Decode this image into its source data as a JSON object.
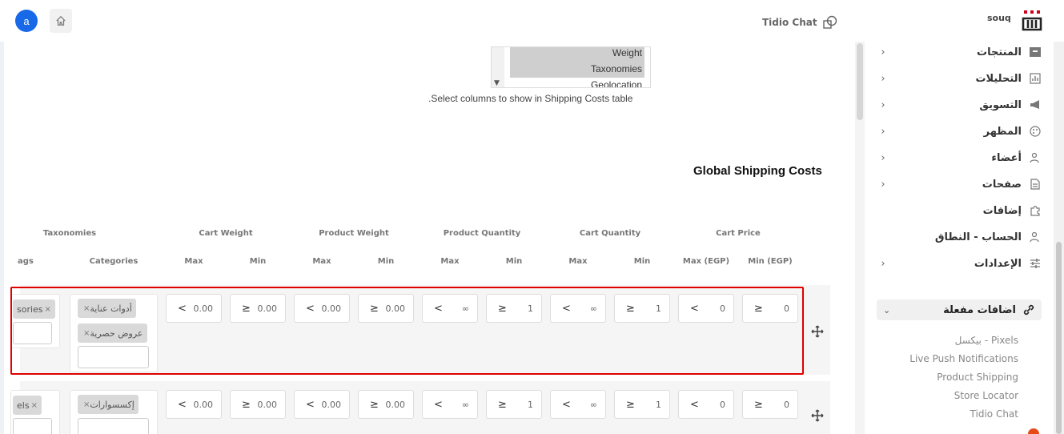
{
  "topbar": {
    "avatar_letter": "a",
    "tidio_label": "Tidio Chat",
    "brand_name": "souq"
  },
  "sidebar": {
    "items": [
      {
        "label": "المنتجات",
        "icon": "archive-icon"
      },
      {
        "label": "التحليلات",
        "icon": "chart-icon"
      },
      {
        "label": "التسويق",
        "icon": "megaphone-icon"
      },
      {
        "label": "المظهر",
        "icon": "palette-icon"
      },
      {
        "label": "أعضاء",
        "icon": "users-icon"
      },
      {
        "label": "صفحات",
        "icon": "page-icon"
      },
      {
        "label": "إضافات",
        "icon": "puzzle-icon"
      },
      {
        "label": "الحساب - النطاق",
        "icon": "user-account-icon"
      },
      {
        "label": "الإعدادات",
        "icon": "sliders-icon"
      }
    ],
    "active_group": {
      "label": "اضافات مفعلة",
      "icon": "link-icon"
    },
    "sub_items": [
      "بيكسل - Pixels",
      "Live Push Notifications",
      "Product Shipping",
      "Store Locator",
      "Tidio Chat"
    ]
  },
  "columns_select": {
    "options": [
      "Weight",
      "Taxonomies",
      "Geolocation"
    ],
    "hint": ".Select columns to show in Shipping Costs table"
  },
  "section_title": "Global Shipping Costs",
  "table": {
    "group_headers": [
      "Cart Price",
      "Cart Quantity",
      "Product Quantity",
      "Product Weight",
      "Cart Weight",
      "Taxonomies"
    ],
    "sub_headers": [
      "Min (EGP)",
      "Max (EGP)",
      "Min",
      "Max",
      "Min",
      "Max",
      "Min",
      "Max",
      "Min",
      "Max",
      "Categories",
      "ags"
    ],
    "rows": [
      {
        "cells": [
          {
            "sym": "≥",
            "val": "0"
          },
          {
            "sym": "<",
            "val": "0"
          },
          {
            "sym": "≥",
            "val": "1"
          },
          {
            "sym": "<",
            "val": "∞"
          },
          {
            "sym": "≥",
            "val": "1"
          },
          {
            "sym": "<",
            "val": "∞"
          },
          {
            "sym": "≥",
            "val": "0.00"
          },
          {
            "sym": "<",
            "val": "0.00"
          },
          {
            "sym": "≥",
            "val": "0.00"
          },
          {
            "sym": "<",
            "val": "0.00"
          }
        ],
        "categories": [
          "أدوات عناية",
          "عروض حصرية"
        ],
        "tags": [
          "sories"
        ]
      },
      {
        "cells": [
          {
            "sym": "≥",
            "val": "0"
          },
          {
            "sym": "<",
            "val": "0"
          },
          {
            "sym": "≥",
            "val": "1"
          },
          {
            "sym": "<",
            "val": "∞"
          },
          {
            "sym": "≥",
            "val": "1"
          },
          {
            "sym": "<",
            "val": "∞"
          },
          {
            "sym": "≥",
            "val": "0.00"
          },
          {
            "sym": "<",
            "val": "0.00"
          },
          {
            "sym": "≥",
            "val": "0.00"
          },
          {
            "sym": "<",
            "val": "0.00"
          }
        ],
        "categories": [
          "إكسسوارات"
        ],
        "tags": [
          "els"
        ]
      }
    ]
  },
  "colors": {
    "accent": "#1769e8",
    "highlight": "#e00000",
    "badge": "#e64a19"
  }
}
